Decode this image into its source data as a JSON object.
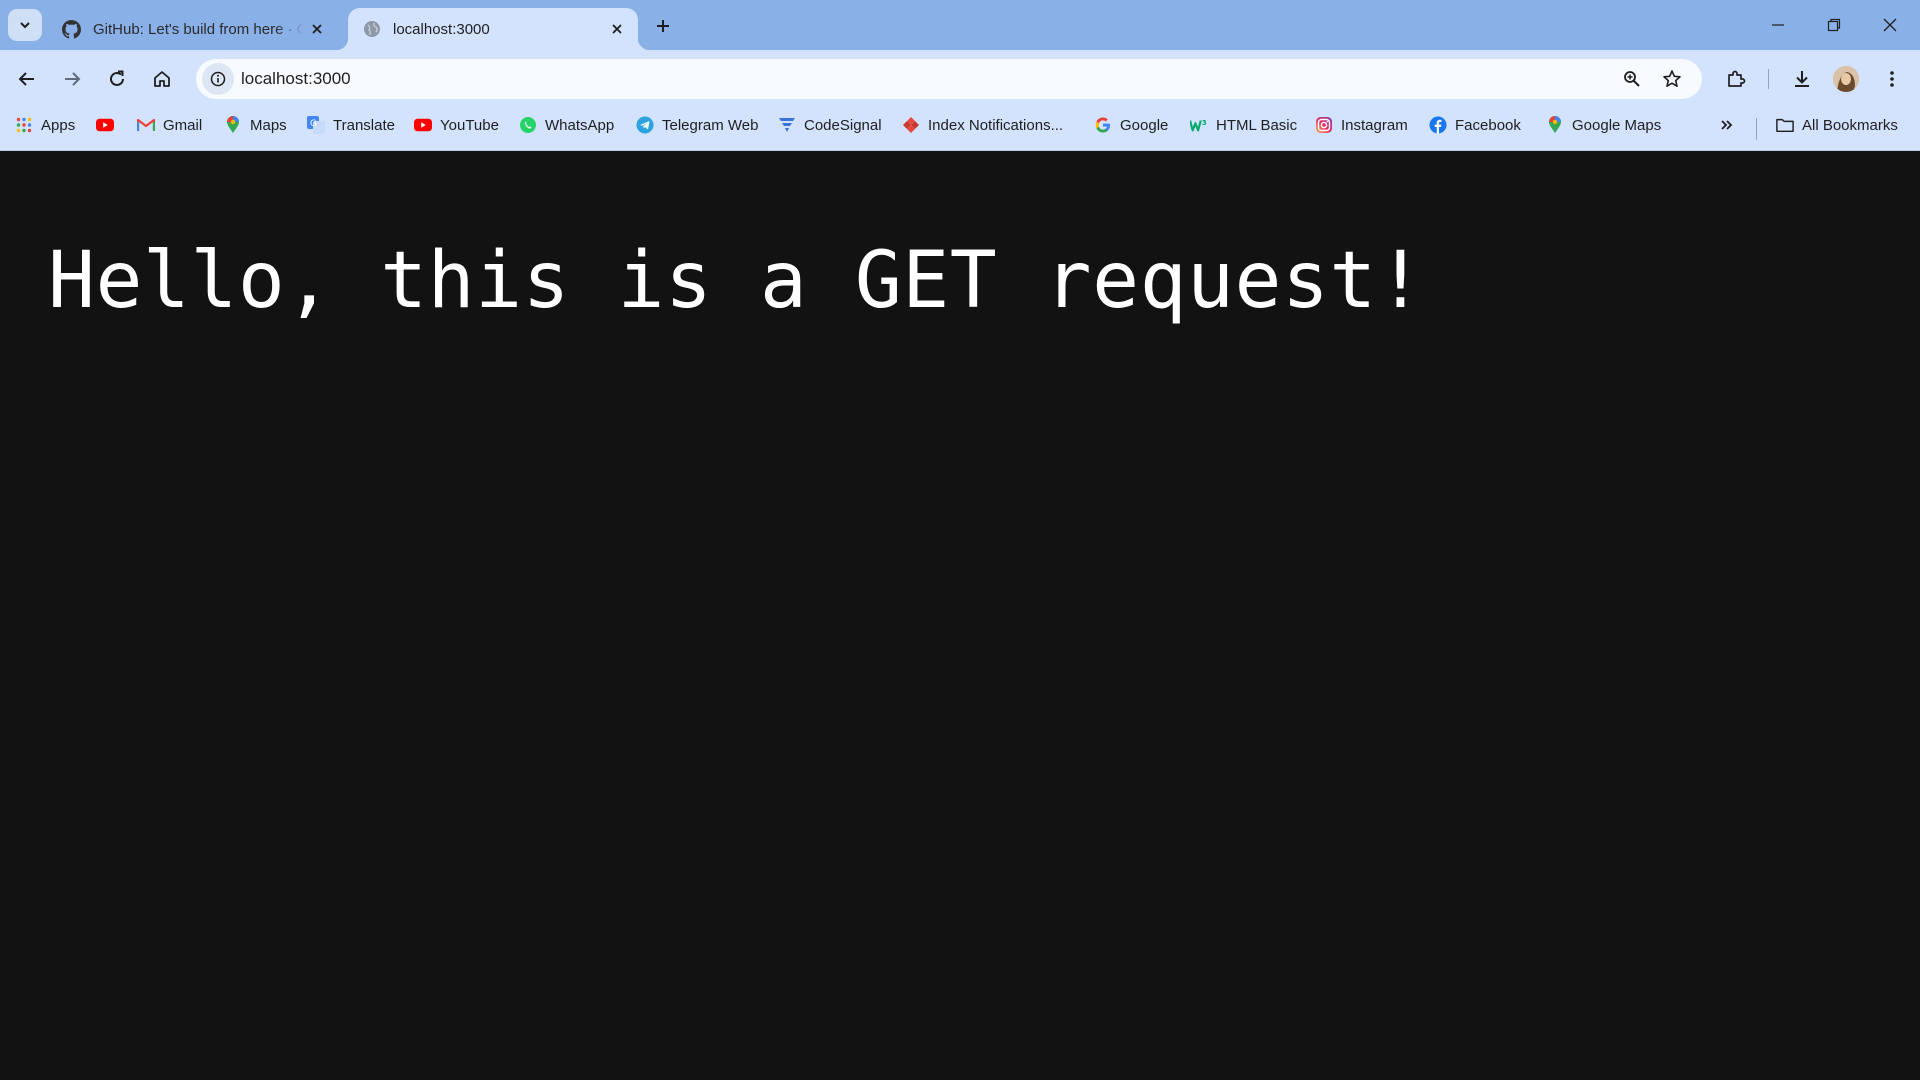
{
  "browser": {
    "tabs": [
      {
        "title": "GitHub: Let's build from here · GitHub",
        "active": false,
        "favicon": "github-icon"
      },
      {
        "title": "localhost:3000",
        "active": true,
        "favicon": "globe-icon"
      }
    ],
    "address_bar": {
      "url": "localhost:3000"
    },
    "bookmarks": [
      {
        "label": "Apps",
        "icon": "apps-grid-icon"
      },
      {
        "label": "",
        "icon": "youtube-icon"
      },
      {
        "label": "Gmail",
        "icon": "gmail-icon"
      },
      {
        "label": "Maps",
        "icon": "maps-pin-icon"
      },
      {
        "label": "Translate",
        "icon": "translate-icon"
      },
      {
        "label": "YouTube",
        "icon": "youtube-icon"
      },
      {
        "label": "WhatsApp",
        "icon": "whatsapp-icon"
      },
      {
        "label": "Telegram Web",
        "icon": "telegram-icon"
      },
      {
        "label": "CodeSignal",
        "icon": "codesignal-icon"
      },
      {
        "label": "Index Notifications...",
        "icon": "diamond-icon"
      },
      {
        "label": "Google",
        "icon": "google-icon"
      },
      {
        "label": "HTML Basic",
        "icon": "w3schools-icon"
      },
      {
        "label": "Instagram",
        "icon": "instagram-icon"
      },
      {
        "label": "Facebook",
        "icon": "facebook-icon"
      },
      {
        "label": "Google Maps",
        "icon": "maps-pin-icon"
      }
    ],
    "all_bookmarks_label": "All Bookmarks"
  },
  "page": {
    "heading": "Hello, this is a GET request!",
    "background_color": "#121212",
    "text_color": "#ffffff"
  }
}
